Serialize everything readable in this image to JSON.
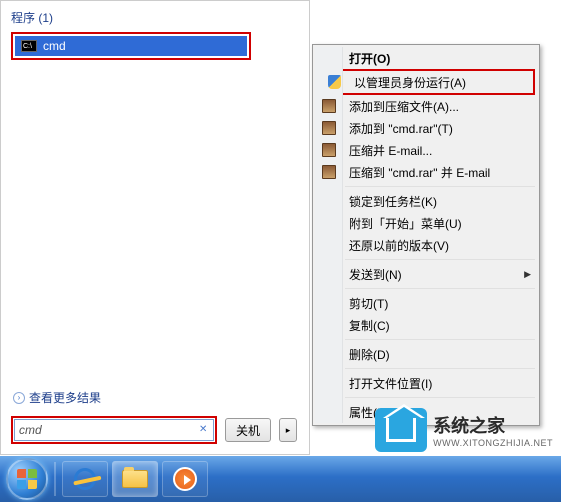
{
  "start": {
    "section_header": "程序 (1)",
    "result_label": "cmd",
    "see_more": "查看更多结果",
    "search_value": "cmd",
    "shutdown_label": "关机"
  },
  "menu": {
    "open": "打开(O)",
    "run_as_admin": "以管理员身份运行(A)",
    "add_to_archive": "添加到压缩文件(A)...",
    "add_to_cmd_rar": "添加到 \"cmd.rar\"(T)",
    "compress_email": "压缩并 E-mail...",
    "compress_cmd_rar_email": "压缩到 \"cmd.rar\" 并 E-mail",
    "pin_taskbar": "锁定到任务栏(K)",
    "pin_start": "附到「开始」菜单(U)",
    "restore_previous": "还原以前的版本(V)",
    "send_to": "发送到(N)",
    "cut": "剪切(T)",
    "copy": "复制(C)",
    "delete": "删除(D)",
    "open_location": "打开文件位置(I)",
    "properties": "属性(R)"
  },
  "brand": {
    "title": "系统之家",
    "url": "WWW.XITONGZHIJIA.NET"
  }
}
